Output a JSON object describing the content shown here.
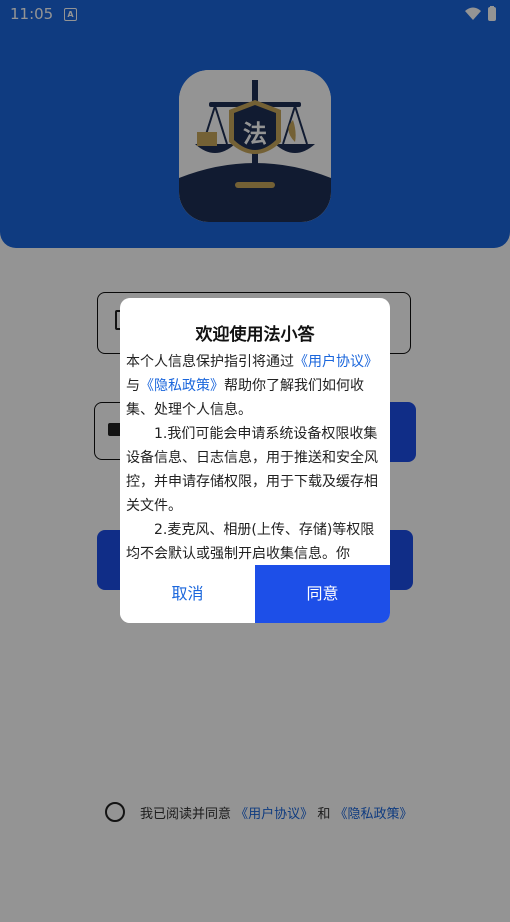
{
  "status_bar": {
    "time": "11:05",
    "notification_badge": "A"
  },
  "colors": {
    "brand_blue": "#1a66dc",
    "button_blue": "#1d4fe8",
    "logo_navy": "#1e2f55",
    "logo_gold": "#c9a75c"
  },
  "logo": {
    "emblem_text": "法"
  },
  "agreement": {
    "prefix": "我已阅读并同意",
    "user_agreement": "《用户协议》",
    "and": "和",
    "privacy_policy": "《隐私政策》"
  },
  "dialog": {
    "title": "欢迎使用法小答",
    "intro_a": "本个人信息保护指引将通过",
    "intro_link_user": "《用户协议》",
    "intro_and": "与",
    "intro_link_privacy": "《隐私政策》",
    "intro_b": "帮助你了解我们如何收集、处理个人信息。",
    "item1": "1.我们可能会申请系统设备权限收集设备信息、日志信息，用于推送和安全风控，并申请存储权限，用于下载及缓存相关文件。",
    "item2": "2.麦克风、相册(上传、存储)等权限均不会默认或强制开启收集信息。你",
    "cancel_label": "取消",
    "agree_label": "同意"
  }
}
